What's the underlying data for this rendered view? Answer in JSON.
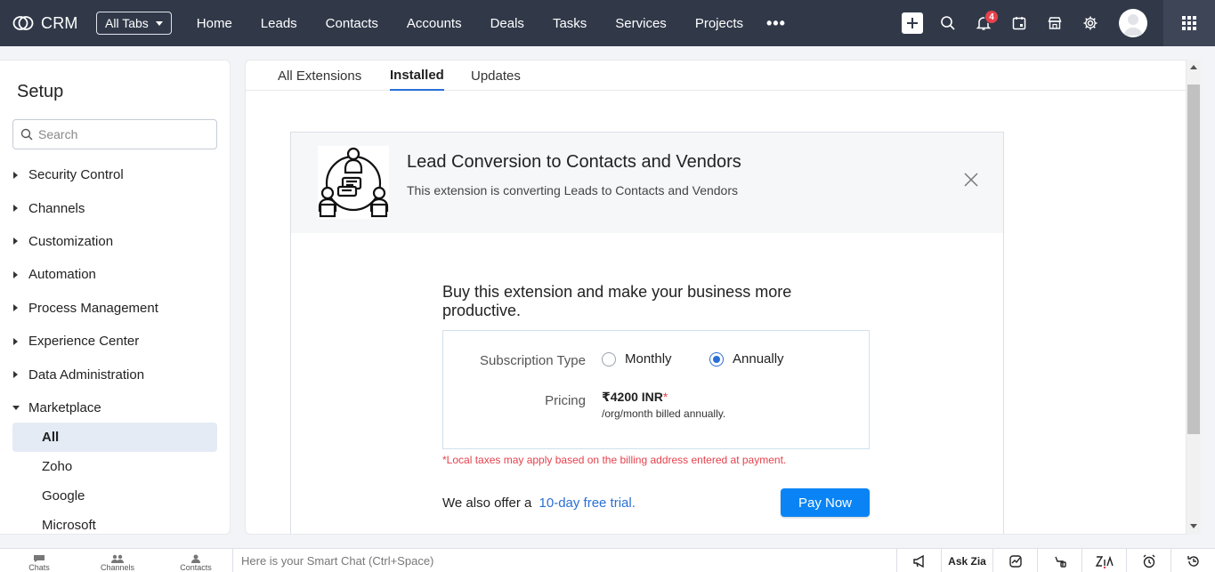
{
  "topbar": {
    "brand": "CRM",
    "all_tabs": "All Tabs",
    "nav": [
      "Home",
      "Leads",
      "Contacts",
      "Accounts",
      "Deals",
      "Tasks",
      "Services",
      "Projects"
    ],
    "more": "•••",
    "notification_count": "4"
  },
  "sidebar": {
    "title": "Setup",
    "search_placeholder": "Search",
    "items": [
      "Security Control",
      "Channels",
      "Customization",
      "Automation",
      "Process Management",
      "Experience Center",
      "Data Administration"
    ],
    "expanded": "Marketplace",
    "subitems": [
      "All",
      "Zoho",
      "Google",
      "Microsoft"
    ],
    "active_subitem": "All"
  },
  "tabs": {
    "all": "All Extensions",
    "installed": "Installed",
    "updates": "Updates",
    "active": "Installed"
  },
  "extension": {
    "title": "Lead Conversion to Contacts and Vendors",
    "description": "This extension is converting Leads to Contacts and Vendors",
    "buy_title": "Buy this extension and make your business more productive.",
    "subscription_label": "Subscription Type",
    "option_monthly": "Monthly",
    "option_annually": "Annually",
    "selected_option": "Annually",
    "pricing_label": "Pricing",
    "price": "₹4200 INR",
    "price_star": "*",
    "price_note": "/org/month billed annually.",
    "tax_note": "*Local taxes may apply based on the billing address entered at payment.",
    "trial_text": "We also offer a",
    "trial_link": "10-day free trial.",
    "pay_button": "Pay Now"
  },
  "bottombar": {
    "chats": "Chats",
    "channels": "Channels",
    "contacts": "Contacts",
    "smart_chat": "Here is your Smart Chat (Ctrl+Space)",
    "ask_zia": "Ask Zia"
  },
  "colors": {
    "topbar": "#313949",
    "accent": "#2a6fd6",
    "pay_button": "#0a84f5",
    "warning": "#e5424d"
  }
}
